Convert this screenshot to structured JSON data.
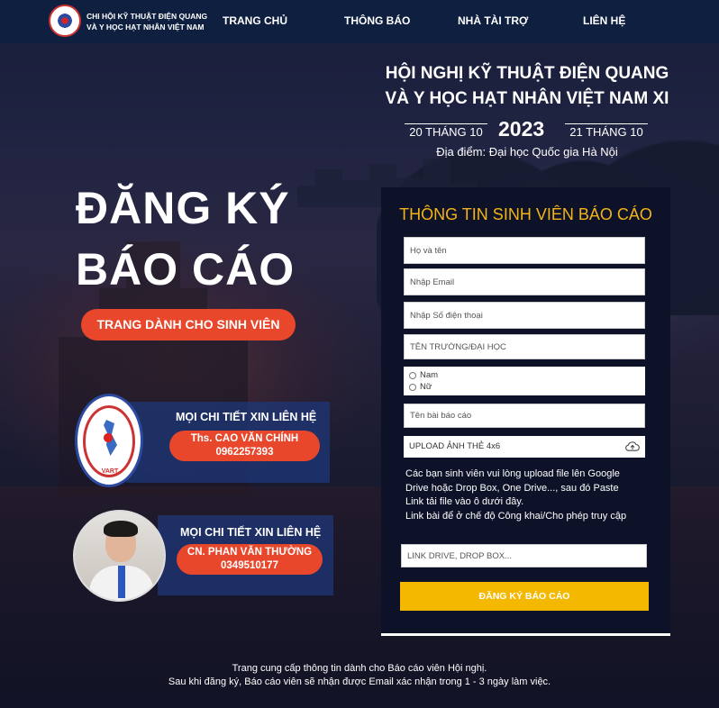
{
  "navbar": {
    "brand_line1": "CHI HỘI KỸ THUẬT ĐIỆN QUANG",
    "brand_line2": "VÀ Y HỌC HẠT NHÂN VIỆT NAM",
    "links": [
      "TRANG CHỦ",
      "THÔNG BÁO",
      "NHÀ TÀI TRỢ",
      "LIÊN HỆ"
    ]
  },
  "conference": {
    "title_line1": "HỘI NGHỊ KỸ THUẬT ĐIỆN QUANG",
    "title_line2": "VÀ Y HỌC HẠT NHÂN VIỆT NAM XI",
    "date_start": "20 THÁNG 10",
    "year": "2023",
    "date_end": "21 THÁNG 10",
    "venue": "Địa điểm: Đại học Quốc gia Hà Nội"
  },
  "hero": {
    "line1": "ĐĂNG KÝ",
    "line2": "BÁO CÁO",
    "student_button": "TRANG DÀNH CHO SINH VIÊN"
  },
  "contacts": [
    {
      "heading": "MỌI CHI TIẾT XIN LIÊN HỆ",
      "name": "Ths. CAO VĂN CHÍNH",
      "phone": "0962257393",
      "avatar_text": "VART"
    },
    {
      "heading": "MỌI CHI TIẾT XIN LIÊN HỆ",
      "name": "CN. PHAN VĂN THƯỜNG",
      "phone": "0349510177"
    }
  ],
  "form": {
    "title": "THÔNG TIN SINH VIÊN BÁO CÁO",
    "fullname_placeholder": "Họ và tên",
    "email_placeholder": "Nhập Email",
    "phone_placeholder": "Nhập Số điện thoại",
    "school_placeholder": "TÊN TRƯỜNG/ĐẠI HỌC",
    "gender_options": [
      "Nam",
      "Nữ"
    ],
    "report_title_placeholder": "Tên bài báo cáo",
    "upload_label": "UPLOAD ẢNH THẺ 4x6",
    "note_line1": "Các bạn sinh viên vui lòng upload file lên Google",
    "note_line2": "Drive hoặc Drop Box, One Drive..., sau đó Paste",
    "note_line3": "Link tải file vào ô dưới đây.",
    "note_line4": "Link bài để ở chế độ Công khai/Cho phép truy cập",
    "link_placeholder": "LINK DRIVE, DROP BOX...",
    "submit_label": "ĐĂNG KÝ BÁO CÁO"
  },
  "footer": {
    "line1": "Trang cung cấp thông tin dành cho Báo cáo viên Hội nghị.",
    "line2": "Sau khi đăng ký, Báo cáo viên sẽ nhận được Email xác nhận trong 1 - 3 ngày làm việc."
  },
  "colors": {
    "navbar_bg": "#0f1f3f",
    "accent_orange": "#e8472c",
    "form_title_yellow": "#f2b418",
    "submit_yellow": "#f5b800",
    "form_panel_bg": "#0d1228"
  }
}
